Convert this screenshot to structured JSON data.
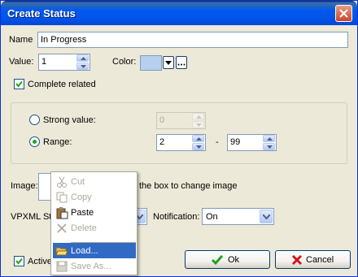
{
  "window": {
    "title": "Create Status"
  },
  "name": {
    "label": "Name",
    "value": "In Progress"
  },
  "value_field": {
    "label": "Value:",
    "value": "1"
  },
  "color": {
    "label": "Color:",
    "swatch": "#B8D0F0"
  },
  "complete_related": {
    "label": "Complete related",
    "checked": true
  },
  "strong_value": {
    "label": "Strong value:",
    "value": "0",
    "selected": false
  },
  "range": {
    "label": "Range:",
    "from": "2",
    "separator": "-",
    "to": "99",
    "selected": true
  },
  "image": {
    "label": "Image:",
    "hint": "the box to  change image"
  },
  "vpxml": {
    "label": "VPXML St"
  },
  "notification": {
    "label": "Notification:",
    "value": "On"
  },
  "active": {
    "label": "Active",
    "checked": true
  },
  "buttons": {
    "ok": "Ok",
    "cancel": "Cancel"
  },
  "context_menu": {
    "items": [
      {
        "label": "Cut",
        "icon": "scissors-icon",
        "enabled": false
      },
      {
        "label": "Copy",
        "icon": "copy-icon",
        "enabled": false
      },
      {
        "label": "Paste",
        "icon": "paste-icon",
        "enabled": true
      },
      {
        "label": "Delete",
        "icon": "delete-icon",
        "enabled": false
      },
      {
        "label": "Load...",
        "icon": "folder-open-icon",
        "enabled": true,
        "highlighted": true
      },
      {
        "label": "Save As...",
        "icon": "save-icon",
        "enabled": false
      }
    ]
  },
  "colors": {
    "titlebar": "#0058EE",
    "dialog_bg": "#ECE9D8",
    "highlight": "#316AC5",
    "ok_check": "#21A121",
    "cancel_x": "#D0161D"
  }
}
